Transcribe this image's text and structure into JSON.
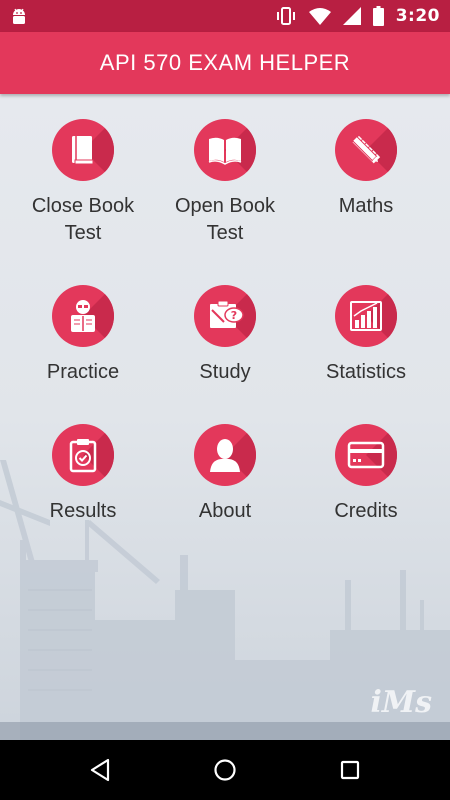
{
  "status_bar": {
    "time": "3:20",
    "icons": [
      "android-icon",
      "vibrate-icon",
      "wifi-icon",
      "signal-icon",
      "battery-icon"
    ]
  },
  "app_bar": {
    "title": "API 570 EXAM HELPER"
  },
  "tiles": [
    {
      "label": "Close Book\nTest",
      "icon": "closed-book-icon"
    },
    {
      "label": "Open Book\nTest",
      "icon": "open-book-icon"
    },
    {
      "label": "Maths",
      "icon": "ruler-pencil-icon"
    },
    {
      "label": "Practice",
      "icon": "reading-person-icon"
    },
    {
      "label": "Study",
      "icon": "study-board-icon"
    },
    {
      "label": "Statistics",
      "icon": "bar-chart-icon"
    },
    {
      "label": "Results",
      "icon": "clipboard-check-icon"
    },
    {
      "label": "About",
      "icon": "person-icon"
    },
    {
      "label": "Credits",
      "icon": "credit-card-icon"
    }
  ],
  "watermark": "iMs",
  "nav_bar": {
    "buttons": [
      "back-icon",
      "home-icon",
      "recents-icon"
    ]
  },
  "colors": {
    "accent": "#e3385b",
    "accent_dark": "#c92a4c",
    "status_bar": "#b81f42",
    "text": "#333333"
  }
}
